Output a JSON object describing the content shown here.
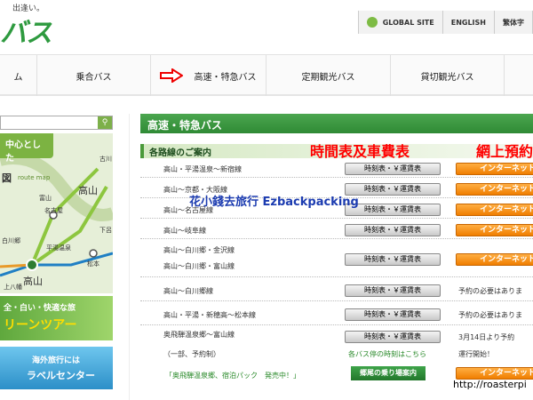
{
  "header": {
    "tagline": "出逢い。",
    "logo": "バス",
    "links": [
      "GLOBAL SITE",
      "ENGLISH",
      "繁体字"
    ]
  },
  "nav": {
    "items": [
      "ム",
      "乗合バス",
      "高速・特急バス",
      "定期観光バス",
      "貸切観光バス"
    ]
  },
  "sidebar": {
    "map_badge": "中心とした",
    "map_title": "図",
    "route_map": "route map",
    "places": [
      "古川",
      "高山",
      "白川郷",
      "富山",
      "名古屋",
      "平湯温泉",
      "松本",
      "高山",
      "上八幡",
      "下呂"
    ],
    "banner1_line1": "全・白い・快適な旅",
    "banner1_line2": "リーンツアー",
    "banner2_line1": "海外旅行には",
    "banner2_line2": "ラベルセンター"
  },
  "main": {
    "title": "高速・特急バス",
    "subtitle": "各路線のご案内",
    "anno_timetable": "時間表及車費表",
    "anno_online": "網上預約",
    "watermark": "花小錢去旅行 Ezbackpacking",
    "timetable_btn": "時刻表・￥運賃表",
    "internet_btn": "インターネット",
    "routes": [
      "高山・平湯温泉～新宿線",
      "高山～京都・大阪線",
      "高山～名古屋線",
      "高山～岐阜線",
      "高山～白川郷・金沢線",
      "高山～白川郷・富山線",
      "高山～白川郷線",
      "高山・平湯・新穂高～松本線",
      "奥飛騨温泉郷～富山線"
    ],
    "notes": [
      "予約の必要はありま",
      "予約の必要はありま",
      "3月14日より予約"
    ],
    "route_sub": "（一部、予約制）",
    "campaign": "「奥飛騨温泉郷、宿泊パック　発売中！」",
    "bus_stop_link": "各バス停の時刻はこちら",
    "start_note": "運行開始！",
    "map_button": "郷尾の乗り場案内",
    "url": "http://roasterpi"
  }
}
